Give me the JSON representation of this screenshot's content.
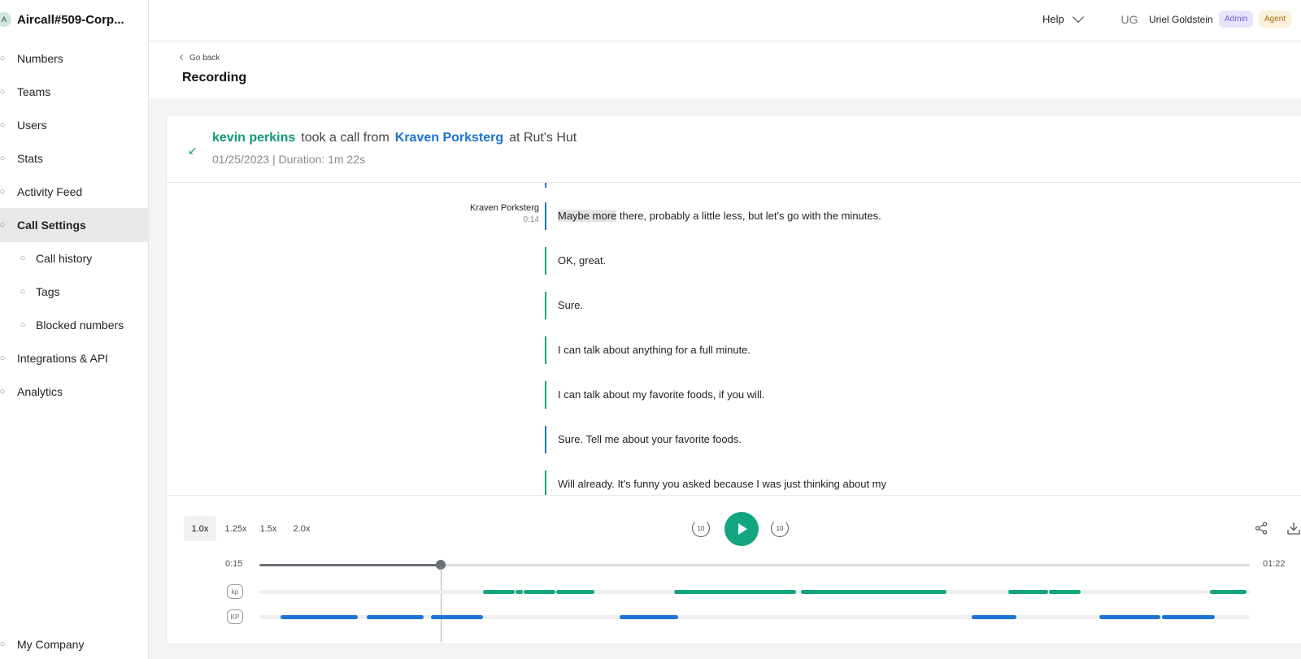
{
  "workspace": {
    "initial": "A",
    "name": "Aircall#509-Corp..."
  },
  "sidebar": {
    "items": [
      {
        "label": "Numbers",
        "icon": "phone-icon"
      },
      {
        "label": "Teams",
        "icon": "teams-icon"
      },
      {
        "label": "Users",
        "icon": "user-icon"
      },
      {
        "label": "Stats",
        "icon": "stats-icon"
      },
      {
        "label": "Activity Feed",
        "icon": "activity-icon"
      },
      {
        "label": "Call Settings",
        "icon": "call-settings-icon",
        "active": true
      },
      {
        "label": "Call history",
        "icon": "history-icon",
        "sub": true
      },
      {
        "label": "Tags",
        "icon": "tag-icon",
        "sub": true
      },
      {
        "label": "Blocked numbers",
        "icon": "blocked-icon",
        "sub": true
      },
      {
        "label": "Integrations & API",
        "icon": "integrations-icon"
      },
      {
        "label": "Analytics",
        "icon": "analytics-icon"
      }
    ],
    "footer": {
      "label": "My Company",
      "icon": "company-icon"
    }
  },
  "topbar": {
    "help": "Help",
    "user_initials": "UG",
    "user_name": "Uriel Goldstein",
    "badges": {
      "admin": "Admin",
      "agent": "Agent"
    }
  },
  "page": {
    "go_back": "Go back",
    "title": "Recording"
  },
  "call": {
    "agent": "kevin perkins",
    "took_text": "took a call from",
    "caller": "Kraven Porksterg",
    "at_text": "at Rut's Hut",
    "meta": "01/25/2023 | Duration: 1m 22s"
  },
  "transcript": [
    {
      "speaker": "Kraven Porksterg",
      "time": "0:14",
      "side": "caller",
      "highlight": "Maybe more",
      "text": " there, probably a little less, but let's go with the minutes."
    },
    {
      "speaker": "",
      "time": "",
      "side": "agent",
      "highlight": "",
      "text": "OK, great."
    },
    {
      "speaker": "",
      "time": "",
      "side": "agent",
      "highlight": "",
      "text": "Sure."
    },
    {
      "speaker": "",
      "time": "",
      "side": "agent",
      "highlight": "",
      "text": "I can talk about anything for a full minute."
    },
    {
      "speaker": "",
      "time": "",
      "side": "agent",
      "highlight": "",
      "text": "I can talk about my favorite foods, if you will."
    },
    {
      "speaker": "",
      "time": "",
      "side": "caller",
      "highlight": "",
      "text": "Sure. Tell me about your favorite foods."
    },
    {
      "speaker": "",
      "time": "",
      "side": "agent",
      "highlight": "",
      "text": "Will already. It's funny you asked because I was just thinking about my"
    }
  ],
  "player": {
    "speeds": [
      "1.0x",
      "1.25x",
      "1.5x",
      "2.0x"
    ],
    "active_speed": "1.0x",
    "skip_back": "10",
    "skip_forward": "10",
    "current_time": "0:15",
    "total_time": "01:22",
    "progress": 0.183,
    "lanes": [
      {
        "initials": "kp",
        "color": "#12a57f",
        "segments": [
          [
            0.226,
            0.258
          ],
          [
            0.259,
            0.266
          ],
          [
            0.267,
            0.299
          ],
          [
            0.3,
            0.338
          ],
          [
            0.419,
            0.542
          ],
          [
            0.547,
            0.694
          ],
          [
            0.756,
            0.796
          ],
          [
            0.797,
            0.829
          ],
          [
            0.96,
            0.997
          ]
        ]
      },
      {
        "initials": "KP",
        "color": "#1b73d3",
        "segments": [
          [
            0.021,
            0.099
          ],
          [
            0.108,
            0.166
          ],
          [
            0.173,
            0.226
          ],
          [
            0.364,
            0.423
          ],
          [
            0.719,
            0.764
          ],
          [
            0.848,
            0.91
          ],
          [
            0.911,
            0.965
          ]
        ]
      }
    ]
  },
  "colors": {
    "agent": "#12a57f",
    "caller": "#1b73d3"
  }
}
